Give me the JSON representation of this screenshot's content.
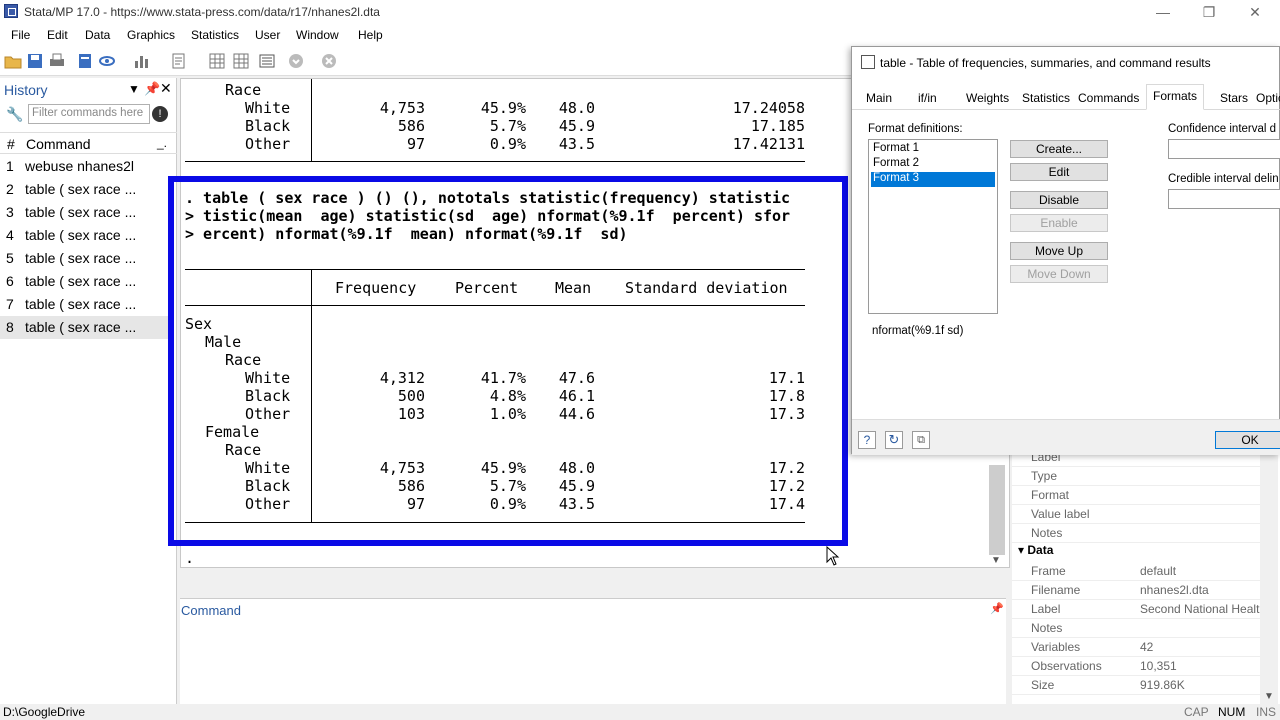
{
  "window": {
    "title": "Stata/MP 17.0 - https://www.stata-press.com/data/r17/nhanes2l.dta"
  },
  "menu": [
    "File",
    "Edit",
    "Data",
    "Graphics",
    "Statistics",
    "User",
    "Window",
    "Help"
  ],
  "history": {
    "title": "History",
    "filter_placeholder": "Filter commands here",
    "col_num": "#",
    "col_cmd": "Command",
    "rows": [
      {
        "n": "1",
        "cmd": "webuse nhanes2l"
      },
      {
        "n": "2",
        "cmd": "table ( sex race ..."
      },
      {
        "n": "3",
        "cmd": "table ( sex race ..."
      },
      {
        "n": "4",
        "cmd": "table ( sex race ..."
      },
      {
        "n": "5",
        "cmd": "table ( sex race ..."
      },
      {
        "n": "6",
        "cmd": "table ( sex race ..."
      },
      {
        "n": "7",
        "cmd": "table ( sex race ..."
      },
      {
        "n": "8",
        "cmd": "table ( sex race ..."
      }
    ]
  },
  "results": {
    "prev": {
      "race_label": "Race",
      "rows": [
        {
          "label": "White",
          "freq": "4,753",
          "pct": "45.9%",
          "mean": "48.0",
          "sd": "17.24058"
        },
        {
          "label": "Black",
          "freq": "586",
          "pct": "5.7%",
          "mean": "45.9",
          "sd": "17.185"
        },
        {
          "label": "Other",
          "freq": "97",
          "pct": "0.9%",
          "mean": "43.5",
          "sd": "17.42131"
        }
      ]
    },
    "command_lines": [
      ". table ( sex race ) () (), nototals statistic(frequency) statistic",
      "> tistic(mean  age) statistic(sd  age) nformat(%9.1f  percent) sfor",
      "> ercent) nformat(%9.1f  mean) nformat(%9.1f  sd)"
    ],
    "headers": {
      "freq": "Frequency",
      "pct": "Percent",
      "mean": "Mean",
      "sd": "Standard deviation"
    },
    "labels": {
      "sex": "Sex",
      "male": "Male",
      "female": "Female",
      "race": "Race"
    },
    "male_rows": [
      {
        "label": "White",
        "freq": "4,312",
        "pct": "41.7%",
        "mean": "47.6",
        "sd": "17.1"
      },
      {
        "label": "Black",
        "freq": "500",
        "pct": "4.8%",
        "mean": "46.1",
        "sd": "17.8"
      },
      {
        "label": "Other",
        "freq": "103",
        "pct": "1.0%",
        "mean": "44.6",
        "sd": "17.3"
      }
    ],
    "female_rows": [
      {
        "label": "White",
        "freq": "4,753",
        "pct": "45.9%",
        "mean": "48.0",
        "sd": "17.2"
      },
      {
        "label": "Black",
        "freq": "586",
        "pct": "5.7%",
        "mean": "45.9",
        "sd": "17.2"
      },
      {
        "label": "Other",
        "freq": "97",
        "pct": "0.9%",
        "mean": "43.5",
        "sd": "17.4"
      }
    ],
    "prompt": "."
  },
  "command_panel": {
    "title": "Command"
  },
  "properties": {
    "var_keys": [
      "Label",
      "Type",
      "Format",
      "Value label",
      "Notes"
    ],
    "data_header": "Data",
    "data_rows": [
      {
        "k": "Frame",
        "v": "default"
      },
      {
        "k": "Filename",
        "v": "nhanes2l.dta"
      },
      {
        "k": "Label",
        "v": "Second National Healt"
      },
      {
        "k": "Notes",
        "v": ""
      },
      {
        "k": "Variables",
        "v": "42"
      },
      {
        "k": "Observations",
        "v": "10,351"
      },
      {
        "k": "Size",
        "v": "919.86K"
      }
    ]
  },
  "dialog": {
    "title": "table - Table of frequencies, summaries, and command results",
    "tabs": [
      "Main",
      "if/in",
      "Weights",
      "Statistics",
      "Commands",
      "Formats",
      "Stars",
      "Optio"
    ],
    "active_tab": "Formats",
    "format_defs_label": "Format definitions:",
    "formats": [
      "Format 1",
      "Format 2",
      "Format 3"
    ],
    "selected_format": "Format 3",
    "buttons": {
      "create": "Create...",
      "edit": "Edit",
      "disable": "Disable",
      "enable": "Enable",
      "move_up": "Move Up",
      "move_down": "Move Down"
    },
    "ci_label": "Confidence interval d",
    "cred_label": "Credible interval delin",
    "format_desc": "nformat(%9.1f  sd)",
    "ok": "OK"
  },
  "status": {
    "path": "D:\\GoogleDrive",
    "caps": "CAP",
    "num": "NUM",
    "ins": "INS"
  },
  "colors": {
    "highlight_border": "#0a0ae6",
    "selection": "#0078d7"
  }
}
